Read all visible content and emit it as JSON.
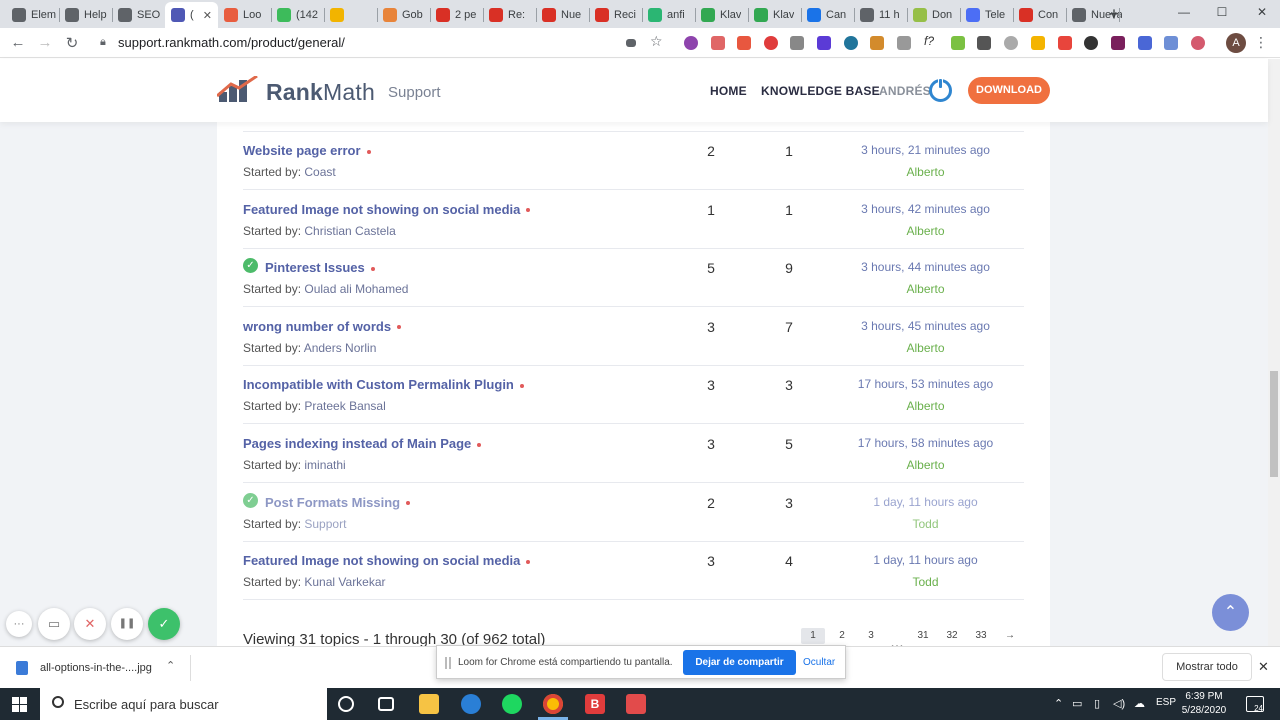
{
  "browser": {
    "tabs": [
      {
        "label": "Elem",
        "color": "#5f6368"
      },
      {
        "label": "Help",
        "color": "#5f6368"
      },
      {
        "label": "SEO",
        "color": "#5f6368"
      },
      {
        "label": "(",
        "color": "#4f58b5"
      },
      {
        "label": "Loo",
        "color": "#e85d3f"
      },
      {
        "label": "(142",
        "color": "#3dbb5b"
      },
      {
        "label": "",
        "color": "#f2b400"
      },
      {
        "label": "Gob",
        "color": "#e8843a"
      },
      {
        "label": "2 pe",
        "color": "#d93025"
      },
      {
        "label": "Re:",
        "color": "#d93025"
      },
      {
        "label": "Nue",
        "color": "#d93025"
      },
      {
        "label": "Reci",
        "color": "#d93025"
      },
      {
        "label": "anfi",
        "color": "#2bb673"
      },
      {
        "label": "Klav",
        "color": "#32a852"
      },
      {
        "label": "Klav",
        "color": "#32a852"
      },
      {
        "label": "Can",
        "color": "#1a73e8"
      },
      {
        "label": "11 h",
        "color": "#5f6368"
      },
      {
        "label": "Don",
        "color": "#96bf48"
      },
      {
        "label": "Tele",
        "color": "#4c6ef5"
      },
      {
        "label": "Con",
        "color": "#d93025"
      },
      {
        "label": "Nueva p",
        "color": "#5f6368"
      }
    ],
    "new_tab": "+",
    "minimize": "—",
    "maximize": "☐",
    "close": "✕",
    "back": "←",
    "forward": "→",
    "reload": "↻",
    "url": "support.rankmath.com/product/general/",
    "profile_initial": "A",
    "menu": "⋮"
  },
  "header": {
    "logo_bold": "Rank",
    "logo_light": "Math",
    "logo_sub": "Support",
    "nav": [
      "HOME",
      "KNOWLEDGE BASE"
    ],
    "user": "ANDRÉS",
    "download": "DOWNLOAD"
  },
  "topics": [
    {
      "title": "Website page error",
      "starter": "Coast",
      "voices": "2",
      "replies": "1",
      "freshness": "3 hours, 21 minutes ago",
      "last_user": "Alberto",
      "resolved": false,
      "faded": false
    },
    {
      "title": "Featured Image not showing on social media",
      "starter": "Christian Castela",
      "voices": "1",
      "replies": "1",
      "freshness": "3 hours, 42 minutes ago",
      "last_user": "Alberto",
      "resolved": false,
      "faded": false
    },
    {
      "title": "Pinterest Issues",
      "starter": "Oulad ali Mohamed",
      "voices": "5",
      "replies": "9",
      "freshness": "3 hours, 44 minutes ago",
      "last_user": "Alberto",
      "resolved": true,
      "faded": false
    },
    {
      "title": "wrong number of words",
      "starter": "Anders Norlin",
      "voices": "3",
      "replies": "7",
      "freshness": "3 hours, 45 minutes ago",
      "last_user": "Alberto",
      "resolved": false,
      "faded": false
    },
    {
      "title": "Incompatible with Custom Permalink Plugin",
      "starter": "Prateek Bansal",
      "voices": "3",
      "replies": "3",
      "freshness": "17 hours, 53 minutes ago",
      "last_user": "Alberto",
      "resolved": false,
      "faded": false
    },
    {
      "title": "Pages indexing instead of Main Page",
      "starter": "iminathi",
      "voices": "3",
      "replies": "5",
      "freshness": "17 hours, 58 minutes ago",
      "last_user": "Alberto",
      "resolved": false,
      "faded": false
    },
    {
      "title": "Post Formats Missing",
      "starter": "Support",
      "voices": "2",
      "replies": "3",
      "freshness": "1 day, 11 hours ago",
      "last_user": "Todd",
      "resolved": true,
      "faded": true
    },
    {
      "title": "Featured Image not showing on social media",
      "starter": "Kunal Varkekar",
      "voices": "3",
      "replies": "4",
      "freshness": "1 day, 11 hours ago",
      "last_user": "Todd",
      "resolved": false,
      "faded": false
    }
  ],
  "started_by_label": "Started by:",
  "pagination": {
    "summary": "Viewing 31 topics - 1 through 30 (of 962 total)",
    "pages": [
      "1",
      "2",
      "3",
      "…",
      "31",
      "32",
      "33",
      "→"
    ]
  },
  "loom": {
    "more": "···",
    "cancel": "✕",
    "pause": "❚❚",
    "done": "✓",
    "share_text": "Loom for Chrome está compartiendo tu pantalla.",
    "stop_sharing": "Dejar de compartir",
    "hide": "Ocultar"
  },
  "scroll_top": "⌃",
  "download_shelf": {
    "file": "all-options-in-the-....jpg",
    "caret": "⌃",
    "show_all": "Mostrar todo",
    "close": "✕"
  },
  "taskbar": {
    "search_placeholder": "Escribe aquí para buscar",
    "language": "ESP",
    "time": "6:39 PM",
    "date": "5/28/2020",
    "notifications": "24"
  }
}
